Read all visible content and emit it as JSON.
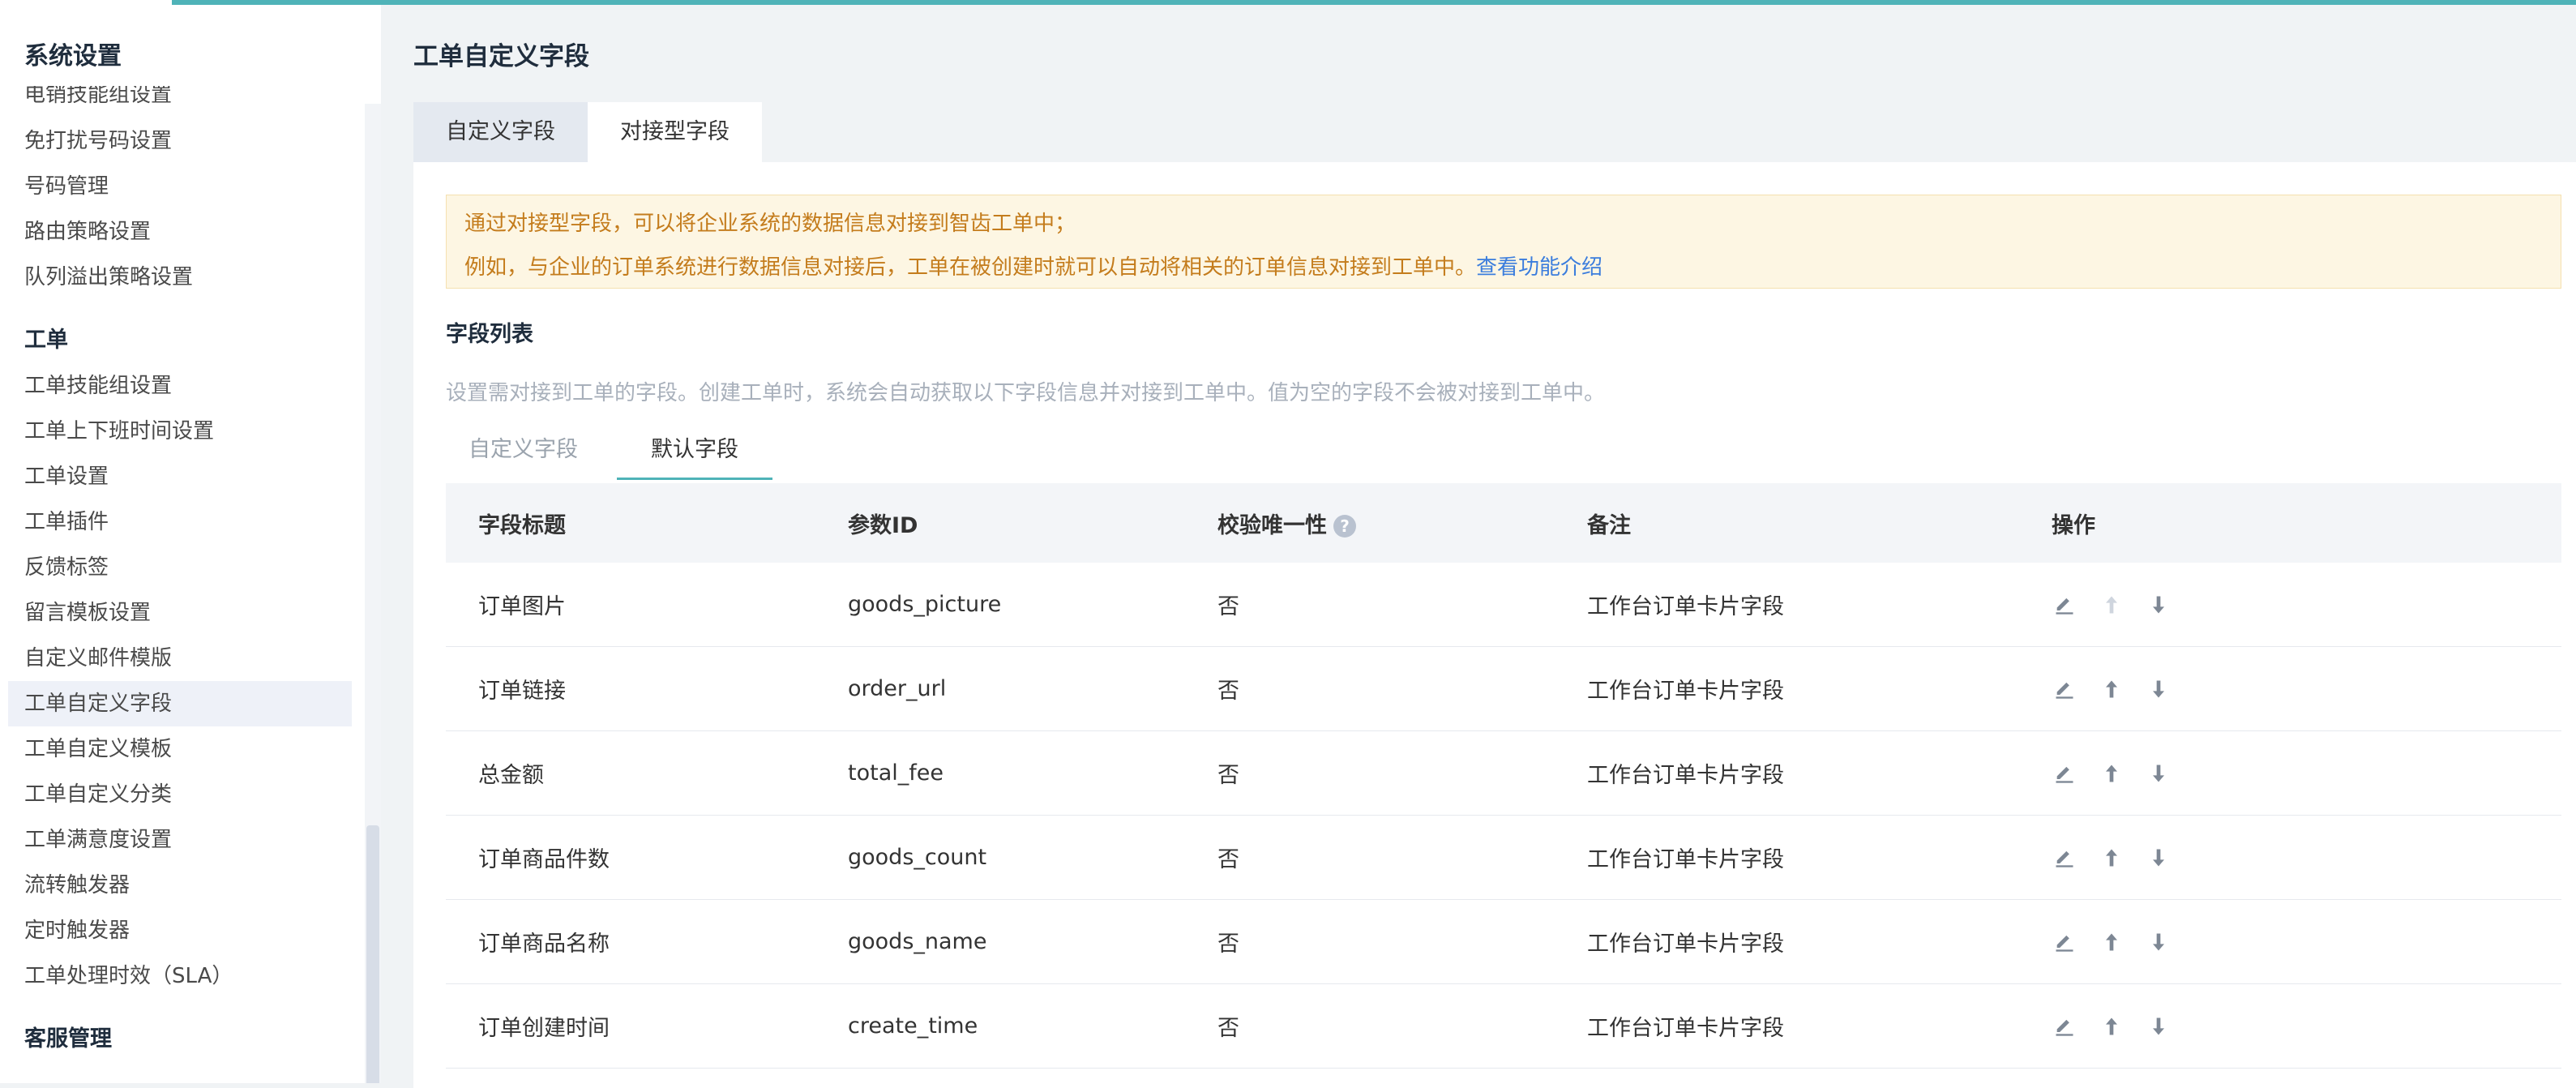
{
  "sidebar": {
    "title": "系统设置",
    "items_top": [
      {
        "label": "电销技能组设置"
      },
      {
        "label": "免打扰号码设置"
      },
      {
        "label": "号码管理"
      },
      {
        "label": "路由策略设置"
      },
      {
        "label": "队列溢出策略设置"
      }
    ],
    "group_ticket": "工单",
    "items_ticket": [
      {
        "label": "工单技能组设置"
      },
      {
        "label": "工单上下班时间设置"
      },
      {
        "label": "工单设置"
      },
      {
        "label": "工单插件"
      },
      {
        "label": "反馈标签"
      },
      {
        "label": "留言模板设置"
      },
      {
        "label": "自定义邮件模版"
      },
      {
        "label": "工单自定义字段",
        "active": true
      },
      {
        "label": "工单自定义模板"
      },
      {
        "label": "工单自定义分类"
      },
      {
        "label": "工单满意度设置"
      },
      {
        "label": "流转触发器"
      },
      {
        "label": "定时触发器"
      },
      {
        "label": "工单处理时效（SLA）"
      }
    ],
    "group_service": "客服管理"
  },
  "main": {
    "title": "工单自定义字段",
    "tabs": [
      {
        "label": "自定义字段",
        "active": false
      },
      {
        "label": "对接型字段",
        "active": true
      }
    ],
    "notice": {
      "line1": "通过对接型字段，可以将企业系统的数据信息对接到智齿工单中；",
      "line2": "例如，与企业的订单系统进行数据信息对接后，工单在被创建时就可以自动将相关的订单信息对接到工单中。",
      "link": "查看功能介绍"
    },
    "section_title": "字段列表",
    "section_desc": "设置需对接到工单的字段。创建工单时，系统会自动获取以下字段信息并对接到工单中。值为空的字段不会被对接到工单中。",
    "sub_tabs": [
      {
        "label": "自定义字段",
        "active": false
      },
      {
        "label": "默认字段",
        "active": true
      }
    ],
    "table": {
      "headers": [
        "字段标题",
        "参数ID",
        "校验唯一性",
        "备注",
        "操作"
      ],
      "help_glyph": "?",
      "rows": [
        {
          "title": "订单图片",
          "param": "goods_picture",
          "unique": "否",
          "note": "工作台订单卡片字段",
          "up_disabled": true
        },
        {
          "title": "订单链接",
          "param": "order_url",
          "unique": "否",
          "note": "工作台订单卡片字段",
          "up_disabled": false
        },
        {
          "title": "总金额",
          "param": "total_fee",
          "unique": "否",
          "note": "工作台订单卡片字段",
          "up_disabled": false
        },
        {
          "title": "订单商品件数",
          "param": "goods_count",
          "unique": "否",
          "note": "工作台订单卡片字段",
          "up_disabled": false
        },
        {
          "title": "订单商品名称",
          "param": "goods_name",
          "unique": "否",
          "note": "工作台订单卡片字段",
          "up_disabled": false
        },
        {
          "title": "订单创建时间",
          "param": "create_time",
          "unique": "否",
          "note": "工作台订单卡片字段",
          "up_disabled": false
        }
      ]
    }
  },
  "colors": {
    "accent": "#4fb3b8",
    "notice_text": "#c47c1c",
    "link": "#3b7ddd",
    "icon": "#7d8794",
    "icon_disabled": "#cfd5de"
  }
}
